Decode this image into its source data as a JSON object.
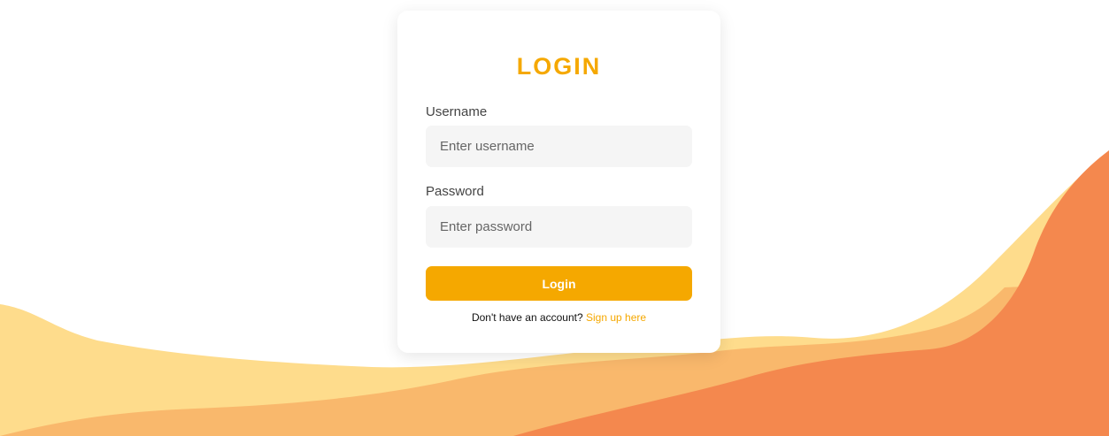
{
  "login_card": {
    "title": "LOGIN",
    "username_label": "Username",
    "username_value": "",
    "username_placeholder": "Enter username",
    "password_label": "Password",
    "password_value": "",
    "password_placeholder": "Enter password",
    "submit_label": "Login",
    "signup_prompt": "Don't have an account?",
    "signup_link": "Sign up here"
  },
  "colors": {
    "accent": "#f5a800",
    "wave_light": "#fedc8c",
    "wave_mid": "#f9b86c",
    "wave_dark": "#f4884e",
    "card_background": "#ffffff",
    "input_background": "#f5f5f5"
  }
}
